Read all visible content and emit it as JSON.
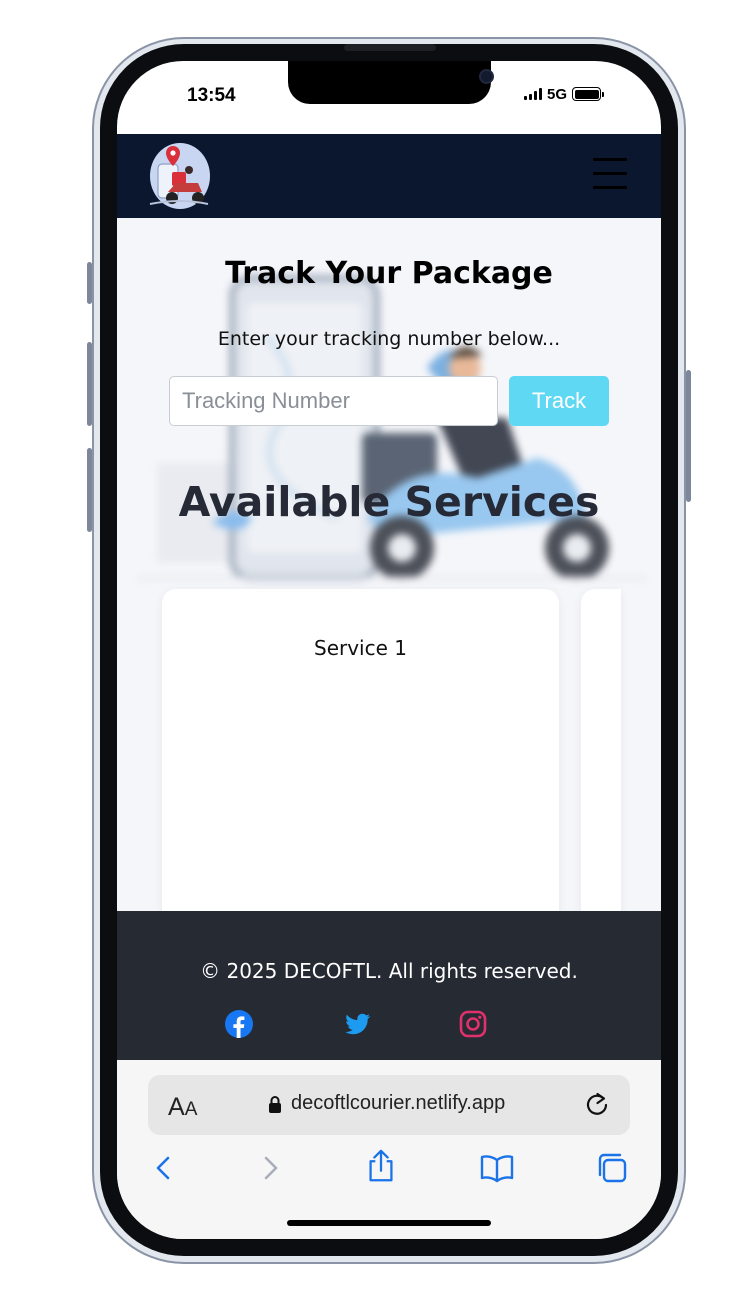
{
  "status_bar": {
    "time": "13:54",
    "network": "5G",
    "battery_level": 1.0
  },
  "header": {
    "logo_icon": "courier-scooter-logo-icon",
    "menu_icon": "hamburger-menu-icon",
    "background": "#0b172e"
  },
  "hero": {
    "title": "Track Your Package",
    "subtitle": "Enter your tracking number below...",
    "tracking_input": {
      "value": "",
      "placeholder": "Tracking Number"
    },
    "track_button_label": "Track",
    "accent_color": "#5fd8f4"
  },
  "services": {
    "title": "Available Services",
    "cards": [
      {
        "label": "Service 1"
      }
    ]
  },
  "footer": {
    "copyright": "© 2025 DECOFTL. All rights reserved.",
    "social": [
      "facebook-icon",
      "twitter-icon",
      "instagram-icon"
    ],
    "background": "#262a33"
  },
  "browser": {
    "text_size_small": "A",
    "text_size_big": "A",
    "url": "decoftlcourier.netlify.app",
    "toolbar": [
      "back-icon",
      "forward-icon",
      "share-icon",
      "bookmarks-icon",
      "tabs-icon"
    ]
  }
}
